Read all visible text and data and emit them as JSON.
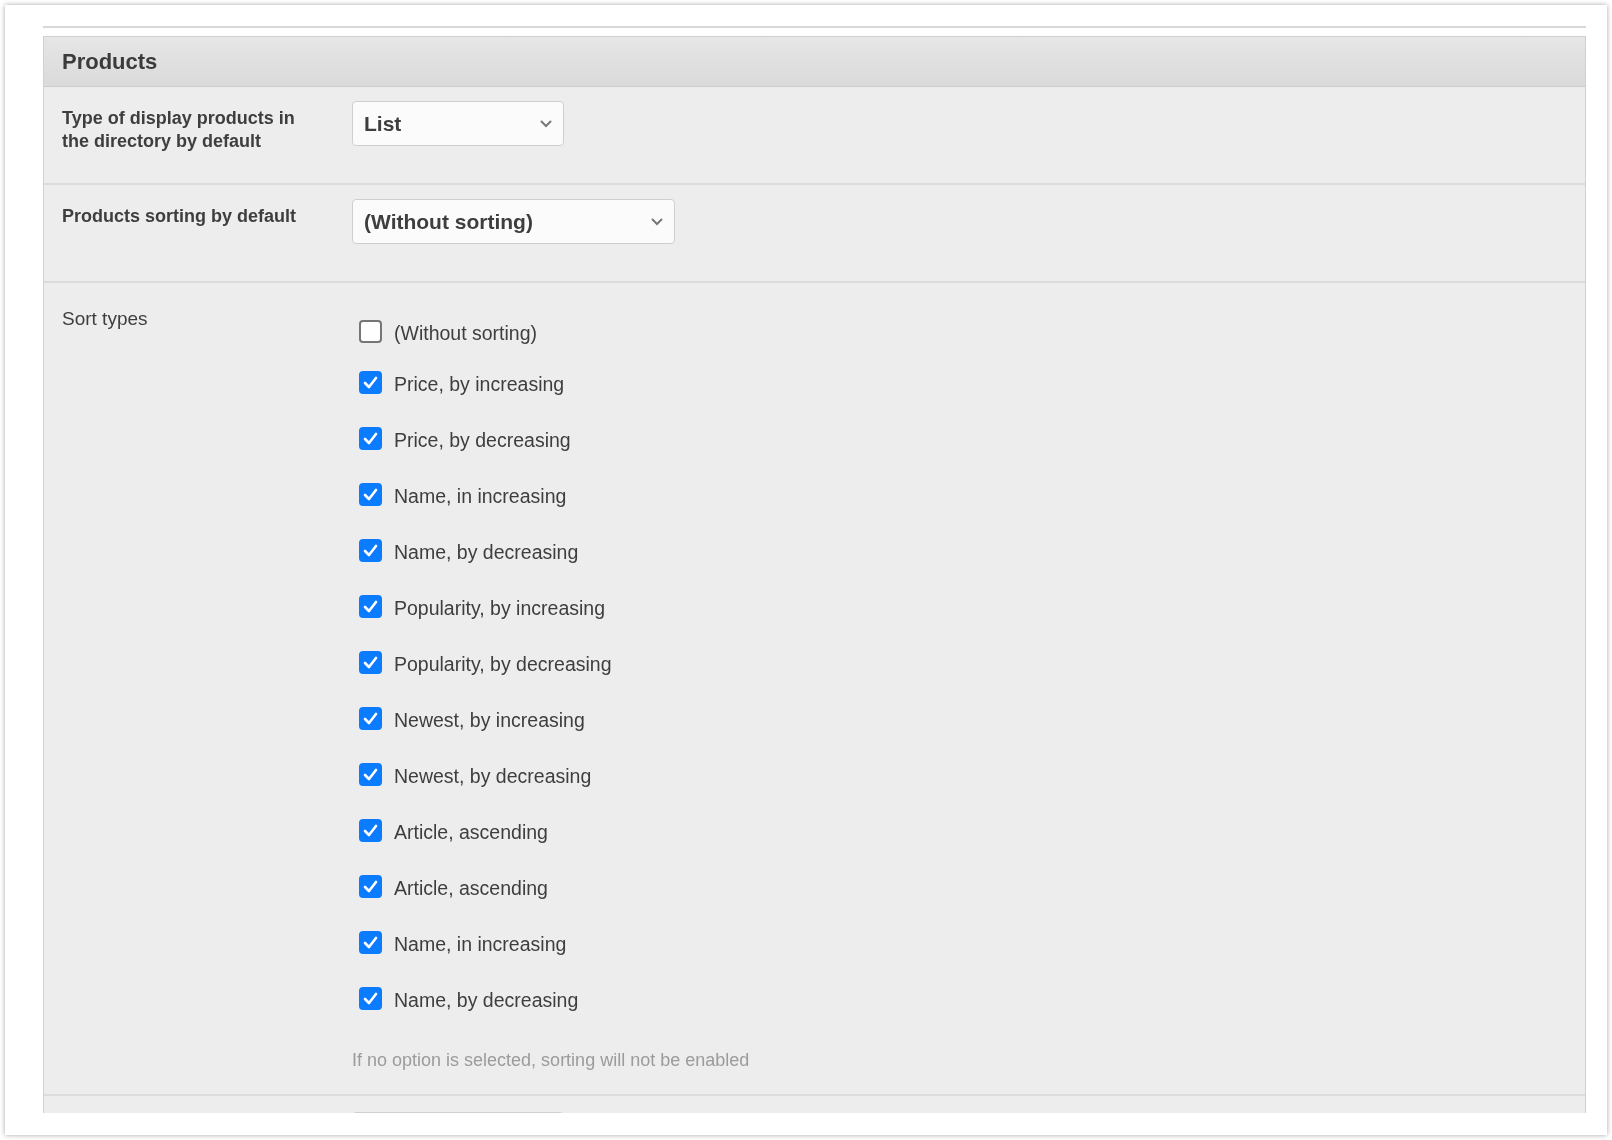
{
  "panel": {
    "title": "Products"
  },
  "settings": [
    {
      "label": "Type of display products in the directory by default",
      "value": "List",
      "kind": "select-short"
    },
    {
      "label": "Products sorting by default",
      "value": "(Without sorting)",
      "kind": "select-wide"
    }
  ],
  "sort_types": {
    "label": "Sort types",
    "options": [
      {
        "label": "(Without sorting)",
        "checked": false
      },
      {
        "label": "Price, by increasing",
        "checked": true
      },
      {
        "label": "Price, by decreasing",
        "checked": true
      },
      {
        "label": "Name, in increasing",
        "checked": true
      },
      {
        "label": "Name, by decreasing",
        "checked": true
      },
      {
        "label": "Popularity, by increasing",
        "checked": true
      },
      {
        "label": "Popularity, by decreasing",
        "checked": true
      },
      {
        "label": "Newest, by increasing",
        "checked": true
      },
      {
        "label": "Newest, by decreasing",
        "checked": true
      },
      {
        "label": "Article, ascending",
        "checked": true
      },
      {
        "label": "Article, ascending",
        "checked": true
      },
      {
        "label": "Name, in increasing",
        "checked": true
      },
      {
        "label": "Name, by decreasing",
        "checked": true
      }
    ],
    "hint": "If no option is selected, sorting will not be enabled"
  }
}
